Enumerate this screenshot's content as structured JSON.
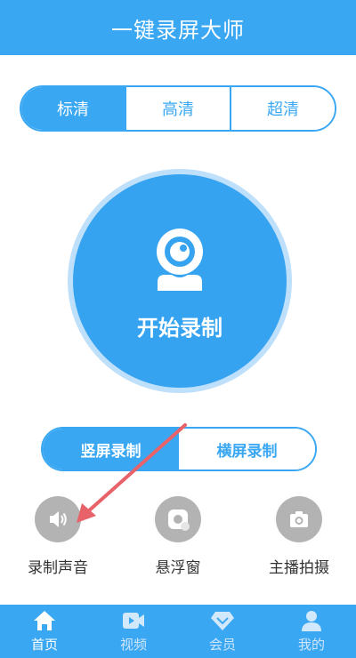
{
  "app": {
    "title": "一键录屏大师"
  },
  "quality": {
    "options": [
      "标清",
      "高清",
      "超清"
    ],
    "selected": "标清"
  },
  "record": {
    "label": "开始录制",
    "icon": "webcam-icon"
  },
  "orientation": {
    "options": [
      "竖屏录制",
      "横屏录制"
    ],
    "selected": "竖屏录制"
  },
  "tools": [
    {
      "label": "录制声音",
      "icon": "speaker-icon"
    },
    {
      "label": "悬浮窗",
      "icon": "floating-window-icon"
    },
    {
      "label": "主播拍摄",
      "icon": "camera-icon"
    }
  ],
  "tabbar": {
    "items": [
      {
        "label": "首页",
        "icon": "home-icon"
      },
      {
        "label": "视频",
        "icon": "video-icon"
      },
      {
        "label": "会员",
        "icon": "diamond-icon"
      },
      {
        "label": "我的",
        "icon": "person-icon"
      }
    ],
    "active": "首页"
  },
  "colors": {
    "primary": "#3aa7f3",
    "record_ring": "#bfe0fb",
    "tool_gray": "#b3b3b3",
    "annotation_arrow": "#e8626a"
  }
}
